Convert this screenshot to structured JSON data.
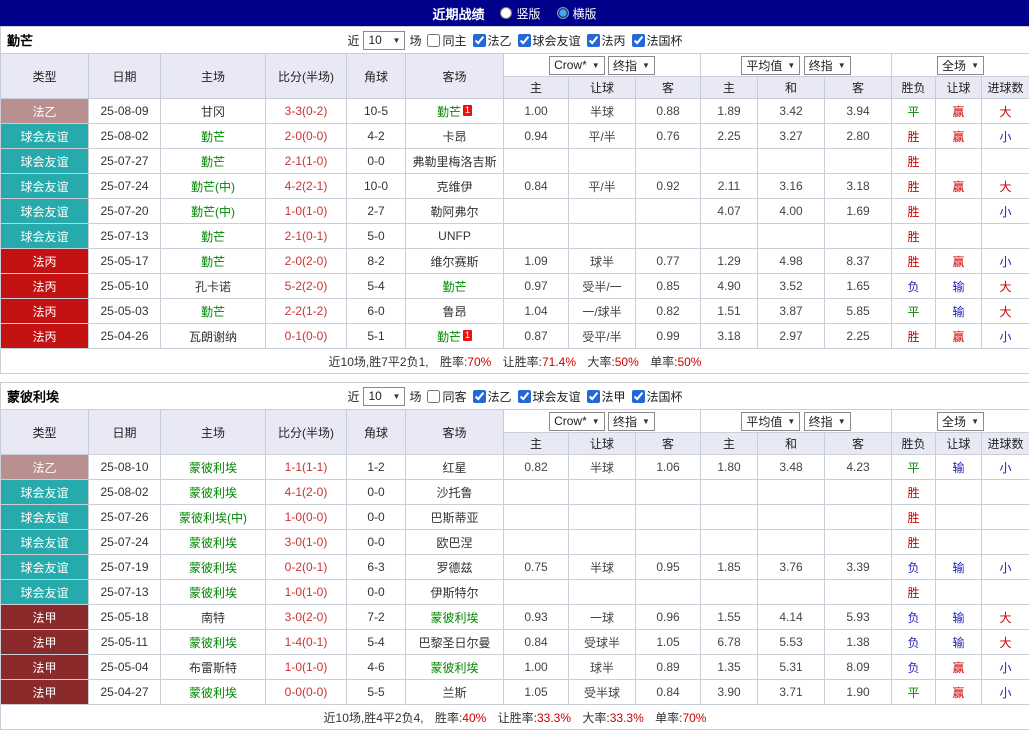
{
  "colors": {
    "navy": "#00008b",
    "header_bg": "#e9e9f6",
    "league_ligue2": "#b98f8f",
    "league_friendly": "#27aaab",
    "league_national": "#c41111",
    "league_ligue1": "#8b2a2a",
    "red": "#cc0000",
    "blue": "#2222bb",
    "green": "#008800",
    "score_red": "#cc3333"
  },
  "top_bar": {
    "title": "近期战绩",
    "layout_options": [
      "竖版",
      "横版"
    ],
    "selected_layout": "横版"
  },
  "sections": [
    {
      "team": "勤芒",
      "filter": {
        "prefix": "近",
        "count": "10",
        "suffix": "场",
        "same_label": "同主",
        "leagues": [
          "法乙",
          "球会友谊",
          "法丙",
          "法国杯"
        ]
      },
      "header": {
        "cols": [
          "类型",
          "日期",
          "主场",
          "比分(半场)",
          "角球",
          "客场"
        ],
        "odds_company": "Crow*",
        "odds_stage": "终指",
        "avg_label": "平均值",
        "avg_stage": "终指",
        "scope": "全场",
        "sub": [
          "主",
          "让球",
          "客",
          "主",
          "和",
          "客",
          "胜负",
          "让球",
          "进球数"
        ]
      },
      "rows": [
        {
          "league": "法乙",
          "lc": "ligue2",
          "date": "25-08-09",
          "home": "甘冈",
          "score": "3-3(0-2)",
          "corner": "10-5",
          "away": "勤芒",
          "as": true,
          "ab": true,
          "o": [
            "1.00",
            "半球",
            "0.88"
          ],
          "a": [
            "1.89",
            "3.42",
            "3.94"
          ],
          "res": [
            "平",
            "g"
          ],
          "han": [
            "赢",
            "r"
          ],
          "goal": [
            "大",
            "r"
          ]
        },
        {
          "league": "球会友谊",
          "lc": "friendly",
          "date": "25-08-02",
          "home": "勤芒",
          "hs": true,
          "score": "2-0(0-0)",
          "corner": "4-2",
          "away": "卡昂",
          "o": [
            "0.94",
            "平/半",
            "0.76"
          ],
          "a": [
            "2.25",
            "3.27",
            "2.80"
          ],
          "res": [
            "胜",
            "r"
          ],
          "han": [
            "赢",
            "r"
          ],
          "goal": [
            "小",
            "b"
          ]
        },
        {
          "league": "球会友谊",
          "lc": "friendly",
          "date": "25-07-27",
          "home": "勤芒",
          "hs": true,
          "score": "2-1(1-0)",
          "corner": "0-0",
          "away": "弗勒里梅洛吉斯",
          "o": [
            "",
            "",
            ""
          ],
          "a": [
            "",
            "",
            ""
          ],
          "res": [
            "胜",
            "r"
          ],
          "han": [
            "",
            ""
          ],
          "goal": [
            "",
            ""
          ]
        },
        {
          "league": "球会友谊",
          "lc": "friendly",
          "date": "25-07-24",
          "home": "勤芒(中)",
          "hs": true,
          "score": "4-2(2-1)",
          "corner": "10-0",
          "away": "克维伊",
          "o": [
            "0.84",
            "平/半",
            "0.92"
          ],
          "a": [
            "2.11",
            "3.16",
            "3.18"
          ],
          "res": [
            "胜",
            "r"
          ],
          "han": [
            "赢",
            "r"
          ],
          "goal": [
            "大",
            "r"
          ]
        },
        {
          "league": "球会友谊",
          "lc": "friendly",
          "date": "25-07-20",
          "home": "勤芒(中)",
          "hs": true,
          "score": "1-0(1-0)",
          "corner": "2-7",
          "away": "勒阿弗尔",
          "o": [
            "",
            "",
            ""
          ],
          "a": [
            "4.07",
            "4.00",
            "1.69"
          ],
          "res": [
            "胜",
            "r"
          ],
          "han": [
            "",
            ""
          ],
          "goal": [
            "小",
            "b"
          ]
        },
        {
          "league": "球会友谊",
          "lc": "friendly",
          "date": "25-07-13",
          "home": "勤芒",
          "hs": true,
          "score": "2-1(0-1)",
          "corner": "5-0",
          "away": "UNFP",
          "o": [
            "",
            "",
            ""
          ],
          "a": [
            "",
            "",
            ""
          ],
          "res": [
            "胜",
            "r"
          ],
          "han": [
            "",
            ""
          ],
          "goal": [
            "",
            ""
          ]
        },
        {
          "league": "法丙",
          "lc": "national",
          "date": "25-05-17",
          "home": "勤芒",
          "hs": true,
          "score": "2-0(2-0)",
          "corner": "8-2",
          "away": "维尔赛斯",
          "o": [
            "1.09",
            "球半",
            "0.77"
          ],
          "a": [
            "1.29",
            "4.98",
            "8.37"
          ],
          "res": [
            "胜",
            "r"
          ],
          "han": [
            "赢",
            "r"
          ],
          "goal": [
            "小",
            "b"
          ]
        },
        {
          "league": "法丙",
          "lc": "national",
          "date": "25-05-10",
          "home": "孔卡诺",
          "score": "5-2(2-0)",
          "corner": "5-4",
          "away": "勤芒",
          "as": true,
          "o": [
            "0.97",
            "受半/一",
            "0.85"
          ],
          "a": [
            "4.90",
            "3.52",
            "1.65"
          ],
          "res": [
            "负",
            "b"
          ],
          "han": [
            "输",
            "b"
          ],
          "goal": [
            "大",
            "r"
          ]
        },
        {
          "league": "法丙",
          "lc": "national",
          "date": "25-05-03",
          "home": "勤芒",
          "hs": true,
          "score": "2-2(1-2)",
          "corner": "6-0",
          "away": "鲁昂",
          "o": [
            "1.04",
            "一/球半",
            "0.82"
          ],
          "a": [
            "1.51",
            "3.87",
            "5.85"
          ],
          "res": [
            "平",
            "g"
          ],
          "han": [
            "输",
            "b"
          ],
          "goal": [
            "大",
            "r"
          ]
        },
        {
          "league": "法丙",
          "lc": "national",
          "date": "25-04-26",
          "home": "瓦朗谢纳",
          "score": "0-1(0-0)",
          "corner": "5-1",
          "away": "勤芒",
          "as": true,
          "ab": true,
          "o": [
            "0.87",
            "受平/半",
            "0.99"
          ],
          "a": [
            "3.18",
            "2.97",
            "2.25"
          ],
          "res": [
            "胜",
            "r"
          ],
          "han": [
            "赢",
            "r"
          ],
          "goal": [
            "小",
            "b"
          ]
        }
      ],
      "summary": {
        "record": "近10场,胜7平2负1,",
        "items": [
          {
            "label": "胜率:",
            "value": "70%"
          },
          {
            "label": "让胜率:",
            "value": "71.4%"
          },
          {
            "label": "大率:",
            "value": "50%"
          },
          {
            "label": "单率:",
            "value": "50%"
          }
        ]
      }
    },
    {
      "team": "蒙彼利埃",
      "filter": {
        "prefix": "近",
        "count": "10",
        "suffix": "场",
        "same_label": "同客",
        "leagues": [
          "法乙",
          "球会友谊",
          "法甲",
          "法国杯"
        ]
      },
      "header": {
        "cols": [
          "类型",
          "日期",
          "主场",
          "比分(半场)",
          "角球",
          "客场"
        ],
        "odds_company": "Crow*",
        "odds_stage": "终指",
        "avg_label": "平均值",
        "avg_stage": "终指",
        "scope": "全场",
        "sub": [
          "主",
          "让球",
          "客",
          "主",
          "和",
          "客",
          "胜负",
          "让球",
          "进球数"
        ]
      },
      "rows": [
        {
          "league": "法乙",
          "lc": "ligue2",
          "date": "25-08-10",
          "home": "蒙彼利埃",
          "hs": true,
          "score": "1-1(1-1)",
          "corner": "1-2",
          "away": "红星",
          "o": [
            "0.82",
            "半球",
            "1.06"
          ],
          "a": [
            "1.80",
            "3.48",
            "4.23"
          ],
          "res": [
            "平",
            "g"
          ],
          "han": [
            "输",
            "b"
          ],
          "goal": [
            "小",
            "b"
          ]
        },
        {
          "league": "球会友谊",
          "lc": "friendly",
          "date": "25-08-02",
          "home": "蒙彼利埃",
          "hs": true,
          "score": "4-1(2-0)",
          "corner": "0-0",
          "away": "沙托鲁",
          "o": [
            "",
            "",
            ""
          ],
          "a": [
            "",
            "",
            ""
          ],
          "res": [
            "胜",
            "r"
          ],
          "han": [
            "",
            ""
          ],
          "goal": [
            "",
            ""
          ]
        },
        {
          "league": "球会友谊",
          "lc": "friendly",
          "date": "25-07-26",
          "home": "蒙彼利埃(中)",
          "hs": true,
          "score": "1-0(0-0)",
          "corner": "0-0",
          "away": "巴斯蒂亚",
          "o": [
            "",
            "",
            ""
          ],
          "a": [
            "",
            "",
            ""
          ],
          "res": [
            "胜",
            "r"
          ],
          "han": [
            "",
            ""
          ],
          "goal": [
            "",
            ""
          ]
        },
        {
          "league": "球会友谊",
          "lc": "friendly",
          "date": "25-07-24",
          "home": "蒙彼利埃",
          "hs": true,
          "score": "3-0(1-0)",
          "corner": "0-0",
          "away": "欧巴涅",
          "o": [
            "",
            "",
            ""
          ],
          "a": [
            "",
            "",
            ""
          ],
          "res": [
            "胜",
            "r"
          ],
          "han": [
            "",
            ""
          ],
          "goal": [
            "",
            ""
          ]
        },
        {
          "league": "球会友谊",
          "lc": "friendly",
          "date": "25-07-19",
          "home": "蒙彼利埃",
          "hs": true,
          "score": "0-2(0-1)",
          "corner": "6-3",
          "away": "罗德兹",
          "o": [
            "0.75",
            "半球",
            "0.95"
          ],
          "a": [
            "1.85",
            "3.76",
            "3.39"
          ],
          "res": [
            "负",
            "b"
          ],
          "han": [
            "输",
            "b"
          ],
          "goal": [
            "小",
            "b"
          ]
        },
        {
          "league": "球会友谊",
          "lc": "friendly",
          "date": "25-07-13",
          "home": "蒙彼利埃",
          "hs": true,
          "score": "1-0(1-0)",
          "corner": "0-0",
          "away": "伊斯特尔",
          "o": [
            "",
            "",
            ""
          ],
          "a": [
            "",
            "",
            ""
          ],
          "res": [
            "胜",
            "r"
          ],
          "han": [
            "",
            ""
          ],
          "goal": [
            "",
            ""
          ]
        },
        {
          "league": "法甲",
          "lc": "ligue1",
          "date": "25-05-18",
          "home": "南特",
          "score": "3-0(2-0)",
          "corner": "7-2",
          "away": "蒙彼利埃",
          "as": true,
          "o": [
            "0.93",
            "一球",
            "0.96"
          ],
          "a": [
            "1.55",
            "4.14",
            "5.93"
          ],
          "res": [
            "负",
            "b"
          ],
          "han": [
            "输",
            "b"
          ],
          "goal": [
            "大",
            "r"
          ]
        },
        {
          "league": "法甲",
          "lc": "ligue1",
          "date": "25-05-11",
          "home": "蒙彼利埃",
          "hs": true,
          "score": "1-4(0-1)",
          "corner": "5-4",
          "away": "巴黎圣日尔曼",
          "o": [
            "0.84",
            "受球半",
            "1.05"
          ],
          "a": [
            "6.78",
            "5.53",
            "1.38"
          ],
          "res": [
            "负",
            "b"
          ],
          "han": [
            "输",
            "b"
          ],
          "goal": [
            "大",
            "r"
          ]
        },
        {
          "league": "法甲",
          "lc": "ligue1",
          "date": "25-05-04",
          "home": "布雷斯特",
          "score": "1-0(1-0)",
          "corner": "4-6",
          "away": "蒙彼利埃",
          "as": true,
          "o": [
            "1.00",
            "球半",
            "0.89"
          ],
          "a": [
            "1.35",
            "5.31",
            "8.09"
          ],
          "res": [
            "负",
            "b"
          ],
          "han": [
            "赢",
            "r"
          ],
          "goal": [
            "小",
            "b"
          ]
        },
        {
          "league": "法甲",
          "lc": "ligue1",
          "date": "25-04-27",
          "home": "蒙彼利埃",
          "hs": true,
          "score": "0-0(0-0)",
          "corner": "5-5",
          "away": "兰斯",
          "o": [
            "1.05",
            "受半球",
            "0.84"
          ],
          "a": [
            "3.90",
            "3.71",
            "1.90"
          ],
          "res": [
            "平",
            "g"
          ],
          "han": [
            "赢",
            "r"
          ],
          "goal": [
            "小",
            "b"
          ]
        }
      ],
      "summary": {
        "record": "近10场,胜4平2负4,",
        "items": [
          {
            "label": "胜率:",
            "value": "40%"
          },
          {
            "label": "让胜率:",
            "value": "33.3%"
          },
          {
            "label": "大率:",
            "value": "33.3%"
          },
          {
            "label": "单率:",
            "value": "70%"
          }
        ]
      }
    }
  ]
}
